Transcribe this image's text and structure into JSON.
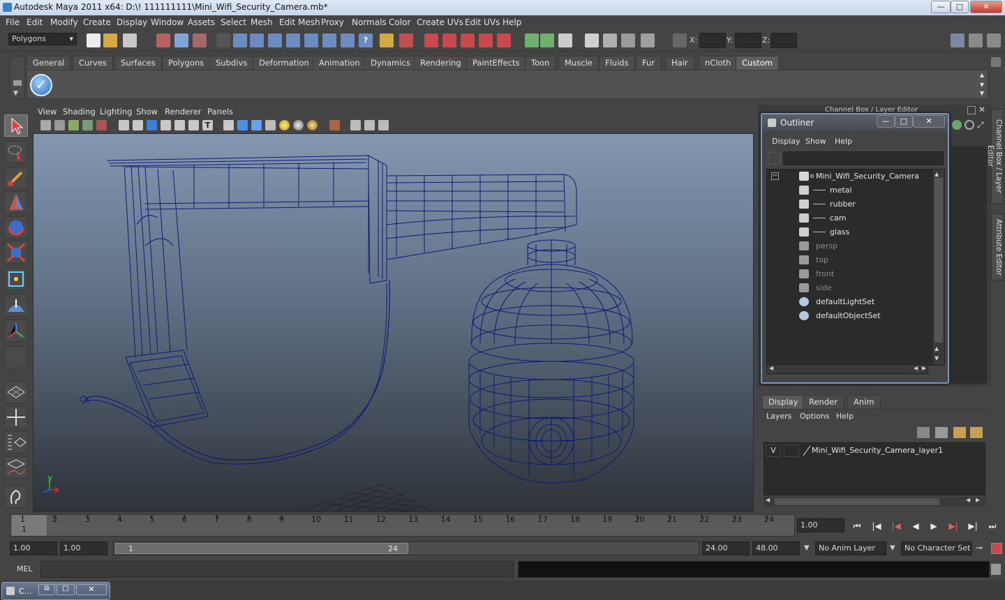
{
  "window": {
    "title": "Autodesk Maya 2011 x64: D:\\! 111111111\\Mini_Wifi_Security_Camera.mb*",
    "minimize": "—",
    "maximize": "□",
    "close": "✕"
  },
  "menu": [
    "File",
    "Edit",
    "Modify",
    "Create",
    "Display",
    "Window",
    "Assets",
    "Select",
    "Mesh",
    "Edit Mesh",
    "Proxy",
    "Normals",
    "Color",
    "Create UVs",
    "Edit UVs",
    "Help"
  ],
  "status_line": {
    "mode": "Polygons",
    "x_label": "X:",
    "y_label": "Y:",
    "z_label": "Z:"
  },
  "shelf": {
    "tabs": [
      "General",
      "Curves",
      "Surfaces",
      "Polygons",
      "Subdivs",
      "Deformation",
      "Animation",
      "Dynamics",
      "Rendering",
      "PaintEffects",
      "Toon",
      "Muscle",
      "Fluids",
      "Fur",
      "Hair",
      "nCloth",
      "Custom"
    ],
    "active_tab": "Custom",
    "custom_icon": "checkmark-icon"
  },
  "viewport": {
    "menu": [
      "View",
      "Shading",
      "Lighting",
      "Show",
      "Renderer",
      "Panels"
    ],
    "axis_x": "x",
    "axis_y": "y",
    "wire_color": "#0d1a78"
  },
  "channel_box": {
    "title": "Channel Box / Layer Editor"
  },
  "side_tabs": [
    "Channel Box / Layer Editor",
    "Attribute Editor"
  ],
  "outliner": {
    "title": "Outliner",
    "menu": [
      "Display",
      "Show",
      "Help"
    ],
    "collapse": "−",
    "items": [
      {
        "label": "Mini_Wifi_Security_Camera",
        "icon": "group-icon",
        "dim": false,
        "indent": 0
      },
      {
        "label": "metal",
        "icon": "mesh-icon",
        "dim": false,
        "indent": 1
      },
      {
        "label": "rubber",
        "icon": "mesh-icon",
        "dim": false,
        "indent": 1
      },
      {
        "label": "cam",
        "icon": "mesh-icon",
        "dim": false,
        "indent": 1
      },
      {
        "label": "glass",
        "icon": "mesh-icon",
        "dim": false,
        "indent": 1
      },
      {
        "label": "persp",
        "icon": "camera-icon",
        "dim": true,
        "indent": 0
      },
      {
        "label": "top",
        "icon": "camera-icon",
        "dim": true,
        "indent": 0
      },
      {
        "label": "front",
        "icon": "camera-icon",
        "dim": true,
        "indent": 0
      },
      {
        "label": "side",
        "icon": "camera-icon",
        "dim": true,
        "indent": 0
      },
      {
        "label": "defaultLightSet",
        "icon": "set-icon",
        "dim": false,
        "indent": 0
      },
      {
        "label": "defaultObjectSet",
        "icon": "set-icon",
        "dim": false,
        "indent": 0
      }
    ]
  },
  "layer_editor": {
    "tabs": [
      "Display",
      "Render",
      "Anim"
    ],
    "active_tab": "Display",
    "menu": [
      "Layers",
      "Options",
      "Help"
    ],
    "layer": {
      "visible": "V",
      "name": "Mini_Wifi_Security_Camera_layer1"
    }
  },
  "time_slider": {
    "frames": [
      "1",
      "2",
      "3",
      "4",
      "5",
      "6",
      "7",
      "8",
      "9",
      "10",
      "11",
      "12",
      "13",
      "14",
      "15",
      "16",
      "17",
      "18",
      "19",
      "20",
      "21",
      "22",
      "23",
      "24"
    ],
    "current_frame_marker": "1",
    "current_time": "1.00"
  },
  "range_slider": {
    "start_time": "1.00",
    "playback_start": "1.00",
    "range_start": "1",
    "range_end": "24",
    "playback_end": "24.00",
    "end_time": "48.00",
    "anim_layer": "No Anim Layer",
    "character_set": "No Character Set"
  },
  "command_line": {
    "label": "MEL"
  },
  "taskbar": {
    "item": "C..."
  }
}
